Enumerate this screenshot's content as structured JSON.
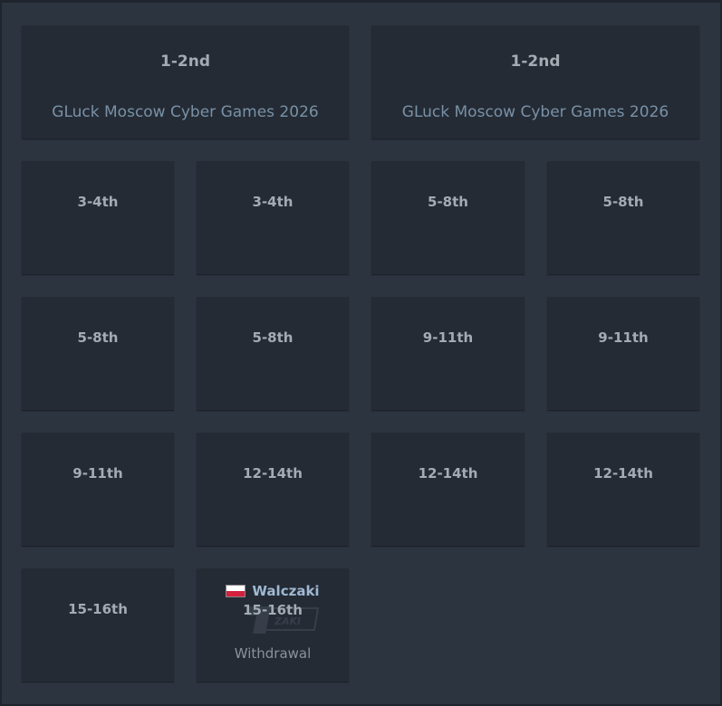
{
  "big_cards": [
    {
      "place": "1-2nd",
      "event": "GLuck Moscow Cyber Games 2026"
    },
    {
      "place": "1-2nd",
      "event": "GLuck Moscow Cyber Games 2026"
    }
  ],
  "cards": [
    {
      "place": "3-4th"
    },
    {
      "place": "3-4th"
    },
    {
      "place": "5-8th"
    },
    {
      "place": "5-8th"
    },
    {
      "place": "5-8th"
    },
    {
      "place": "5-8th"
    },
    {
      "place": "9-11th"
    },
    {
      "place": "9-11th"
    },
    {
      "place": "9-11th"
    },
    {
      "place": "12-14th"
    },
    {
      "place": "12-14th"
    },
    {
      "place": "12-14th"
    },
    {
      "place": "15-16th"
    },
    {
      "place": "15-16th",
      "team": "Walczaki",
      "status": "Withdrawal",
      "flag_icon": "poland-flag-icon"
    }
  ],
  "colors": {
    "background": "#2c3440",
    "card": "#242b35",
    "place_text": "#a3abb3",
    "event_link": "#7991a6",
    "team_link": "#9fb8d3",
    "flag_white": "#ffffff",
    "flag_red": "#d4213d"
  }
}
